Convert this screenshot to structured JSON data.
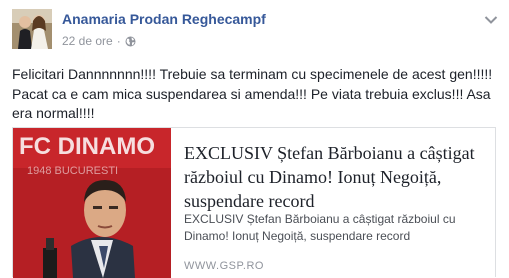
{
  "post": {
    "author": "Anamaria Prodan Reghecampf",
    "timestamp": "22 de ore",
    "separator": "·",
    "privacy_icon": "globe-icon",
    "menu_icon": "chevron-down-icon",
    "text": "Felicitari Dannnnnnn!!!! Trebuie sa terminam cu specimenele de acest gen!!!!! Pacat ca e cam mica suspendarea si amenda!!! Pe viata trebuia exclus!!! Asa era normal!!!!"
  },
  "link": {
    "image_banner_text": "FC DINAMO",
    "image_banner_sub": "1948 BUCURESTI",
    "title": "EXCLUSIV Ștefan Bărboianu a câștigat războiul cu Dinamo! Ionuț Negoiță, suspendare record",
    "description": "EXCLUSIV Ștefan Bărboianu a câștigat războiul cu Dinamo! Ionuț Negoiță, suspendare record",
    "source": "WWW.GSP.RO"
  },
  "colors": {
    "author_link": "#365899",
    "meta_gray": "#90949c",
    "body_text": "#1d2129",
    "dinamo_red": "#b51f24"
  }
}
